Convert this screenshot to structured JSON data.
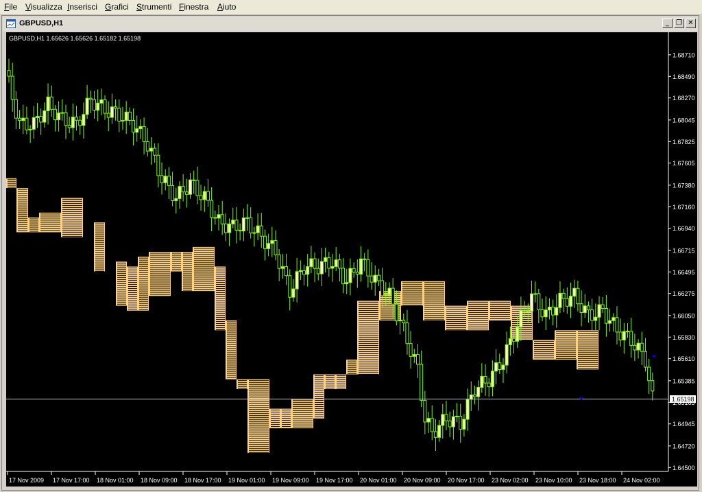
{
  "menu": {
    "items": [
      {
        "label": "File",
        "acc": "F",
        "rest": "ile"
      },
      {
        "label": "Visualizza",
        "acc": "V",
        "rest": "isualizza"
      },
      {
        "label": "Inserisci",
        "acc": "I",
        "rest": "nserisci"
      },
      {
        "label": "Grafici",
        "acc": "G",
        "rest": "rafici"
      },
      {
        "label": "Strumenti",
        "acc": "S",
        "rest": "trumenti"
      },
      {
        "label": "Finestra",
        "acc": "F",
        "rest": "inestra"
      },
      {
        "label": "Aiuto",
        "acc": "A",
        "rest": "iuto"
      }
    ]
  },
  "window": {
    "title": "GBPUSD,H1",
    "minimize": "_",
    "restore": "❐",
    "close": "✕"
  },
  "icons": {
    "window": "chart-window-icon"
  },
  "colors": {
    "background": "#000000",
    "candle_bull": "#ffffc0",
    "candle_wick": "#7cfc00",
    "profile_fill": "#ffd27f",
    "profile_stripe": "#000000",
    "axis": "#ffffff",
    "marker": "#0000ff",
    "bid_line": "#c0c0c0"
  },
  "chart_data": {
    "type": "candlestick",
    "symbol_info": "GBPUSD,H1  1.65626  1.65626  1.65182  1.65198",
    "y_ticks": [
      1.6871,
      1.6849,
      1.6827,
      1.68045,
      1.67825,
      1.67605,
      1.6738,
      1.6716,
      1.6694,
      1.66715,
      1.66495,
      1.66275,
      1.6605,
      1.6583,
      1.6561,
      1.65385,
      1.65165,
      1.64945,
      1.6472,
      1.645
    ],
    "y_tick_labels": [
      "1.68710",
      "1.68490",
      "1.68270",
      "1.68045",
      "1.67825",
      "1.67605",
      "1.67380",
      "1.67160",
      "1.66940",
      "1.66715",
      "1.66495",
      "1.66275",
      "1.66050",
      "1.65830",
      "1.65610",
      "1.65385",
      "1.65165",
      "1.64945",
      "1.64720",
      "1.64500"
    ],
    "ylim": [
      1.6446,
      1.6894
    ],
    "x_tick_labels": [
      "17 Nov 2009",
      "17 Nov 17:00",
      "18 Nov 01:00",
      "18 Nov 09:00",
      "18 Nov 17:00",
      "19 Nov 01:00",
      "19 Nov 09:00",
      "19 Nov 17:00",
      "20 Nov 01:00",
      "20 Nov 09:00",
      "20 Nov 17:00",
      "23 Nov 02:00",
      "23 Nov 10:00",
      "23 Nov 18:00",
      "24 Nov 02:00"
    ],
    "bid_price": "1.65198",
    "bid_value": 1.65198,
    "candles_count": 120,
    "close_path": [
      [
        0,
        1.6855
      ],
      [
        4,
        1.68
      ],
      [
        8,
        1.68
      ],
      [
        12,
        1.682
      ],
      [
        16,
        1.6805
      ],
      [
        20,
        1.68
      ],
      [
        24,
        1.6825
      ],
      [
        28,
        1.6815
      ],
      [
        32,
        1.681
      ],
      [
        36,
        1.68
      ],
      [
        40,
        1.678
      ],
      [
        44,
        1.6745
      ],
      [
        48,
        1.6725
      ],
      [
        52,
        1.674
      ],
      [
        56,
        1.6725
      ],
      [
        60,
        1.67
      ],
      [
        64,
        1.6695
      ],
      [
        68,
        1.67
      ],
      [
        72,
        1.6685
      ],
      [
        76,
        1.667
      ],
      [
        80,
        1.663
      ],
      [
        84,
        1.6655
      ],
      [
        88,
        1.6655
      ],
      [
        92,
        1.666
      ],
      [
        96,
        1.664
      ],
      [
        100,
        1.666
      ],
      [
        104,
        1.664
      ],
      [
        108,
        1.6625
      ],
      [
        112,
        1.659
      ],
      [
        116,
        1.655
      ],
      [
        118,
        1.65
      ],
      [
        120,
        1.6485
      ],
      [
        124,
        1.65
      ],
      [
        128,
        1.6495
      ],
      [
        132,
        1.653
      ],
      [
        136,
        1.654
      ],
      [
        140,
        1.656
      ],
      [
        144,
        1.6595
      ],
      [
        148,
        1.6625
      ],
      [
        152,
        1.6605
      ],
      [
        156,
        1.662
      ],
      [
        160,
        1.6625
      ],
      [
        164,
        1.6605
      ],
      [
        168,
        1.661
      ],
      [
        172,
        1.659
      ],
      [
        176,
        1.658
      ],
      [
        180,
        1.656
      ],
      [
        182,
        1.652
      ]
    ],
    "profile_blocks": [
      {
        "x0": 0,
        "x1": 15,
        "y0": 1.6745,
        "y1": 1.6735
      },
      {
        "x0": 15,
        "x1": 32,
        "y0": 1.6735,
        "y1": 1.669
      },
      {
        "x0": 32,
        "x1": 48,
        "y0": 1.6705,
        "y1": 1.669
      },
      {
        "x0": 48,
        "x1": 80,
        "y0": 1.671,
        "y1": 1.669
      },
      {
        "x0": 80,
        "x1": 112,
        "y0": 1.6725,
        "y1": 1.6685
      },
      {
        "x0": 128,
        "x1": 144,
        "y0": 1.67,
        "y1": 1.665
      },
      {
        "x0": 160,
        "x1": 176,
        "y0": 1.666,
        "y1": 1.6615
      },
      {
        "x0": 176,
        "x1": 192,
        "y0": 1.6655,
        "y1": 1.661
      },
      {
        "x0": 192,
        "x1": 208,
        "y0": 1.6665,
        "y1": 1.661
      },
      {
        "x0": 208,
        "x1": 240,
        "y0": 1.667,
        "y1": 1.6625
      },
      {
        "x0": 240,
        "x1": 256,
        "y0": 1.667,
        "y1": 1.665
      },
      {
        "x0": 256,
        "x1": 272,
        "y0": 1.667,
        "y1": 1.663
      },
      {
        "x0": 272,
        "x1": 304,
        "y0": 1.6675,
        "y1": 1.663
      },
      {
        "x0": 304,
        "x1": 320,
        "y0": 1.6655,
        "y1": 1.659
      },
      {
        "x0": 320,
        "x1": 336,
        "y0": 1.66,
        "y1": 1.654
      },
      {
        "x0": 336,
        "x1": 352,
        "y0": 1.654,
        "y1": 1.653
      },
      {
        "x0": 352,
        "x1": 384,
        "y0": 1.654,
        "y1": 1.6465
      },
      {
        "x0": 384,
        "x1": 400,
        "y0": 1.651,
        "y1": 1.649
      },
      {
        "x0": 400,
        "x1": 416,
        "y0": 1.651,
        "y1": 1.649
      },
      {
        "x0": 416,
        "x1": 448,
        "y0": 1.652,
        "y1": 1.649
      },
      {
        "x0": 448,
        "x1": 464,
        "y0": 1.6545,
        "y1": 1.65
      },
      {
        "x0": 464,
        "x1": 480,
        "y0": 1.6545,
        "y1": 1.653
      },
      {
        "x0": 480,
        "x1": 496,
        "y0": 1.6545,
        "y1": 1.653
      },
      {
        "x0": 496,
        "x1": 512,
        "y0": 1.656,
        "y1": 1.6545
      },
      {
        "x0": 512,
        "x1": 544,
        "y0": 1.662,
        "y1": 1.6545
      },
      {
        "x0": 544,
        "x1": 576,
        "y0": 1.663,
        "y1": 1.66
      },
      {
        "x0": 576,
        "x1": 608,
        "y0": 1.664,
        "y1": 1.6615
      },
      {
        "x0": 608,
        "x1": 640,
        "y0": 1.664,
        "y1": 1.66
      },
      {
        "x0": 640,
        "x1": 672,
        "y0": 1.6615,
        "y1": 1.659
      },
      {
        "x0": 672,
        "x1": 704,
        "y0": 1.662,
        "y1": 1.659
      },
      {
        "x0": 704,
        "x1": 736,
        "y0": 1.662,
        "y1": 1.66
      },
      {
        "x0": 736,
        "x1": 768,
        "y0": 1.6615,
        "y1": 1.658
      },
      {
        "x0": 768,
        "x1": 800,
        "y0": 1.658,
        "y1": 1.656
      },
      {
        "x0": 800,
        "x1": 832,
        "y0": 1.659,
        "y1": 1.656
      },
      {
        "x0": 832,
        "x1": 864,
        "y0": 1.659,
        "y1": 1.655
      }
    ],
    "markers": [
      {
        "x": 839,
        "y": 1.652
      },
      {
        "x": 945,
        "y": 1.6563
      }
    ]
  }
}
